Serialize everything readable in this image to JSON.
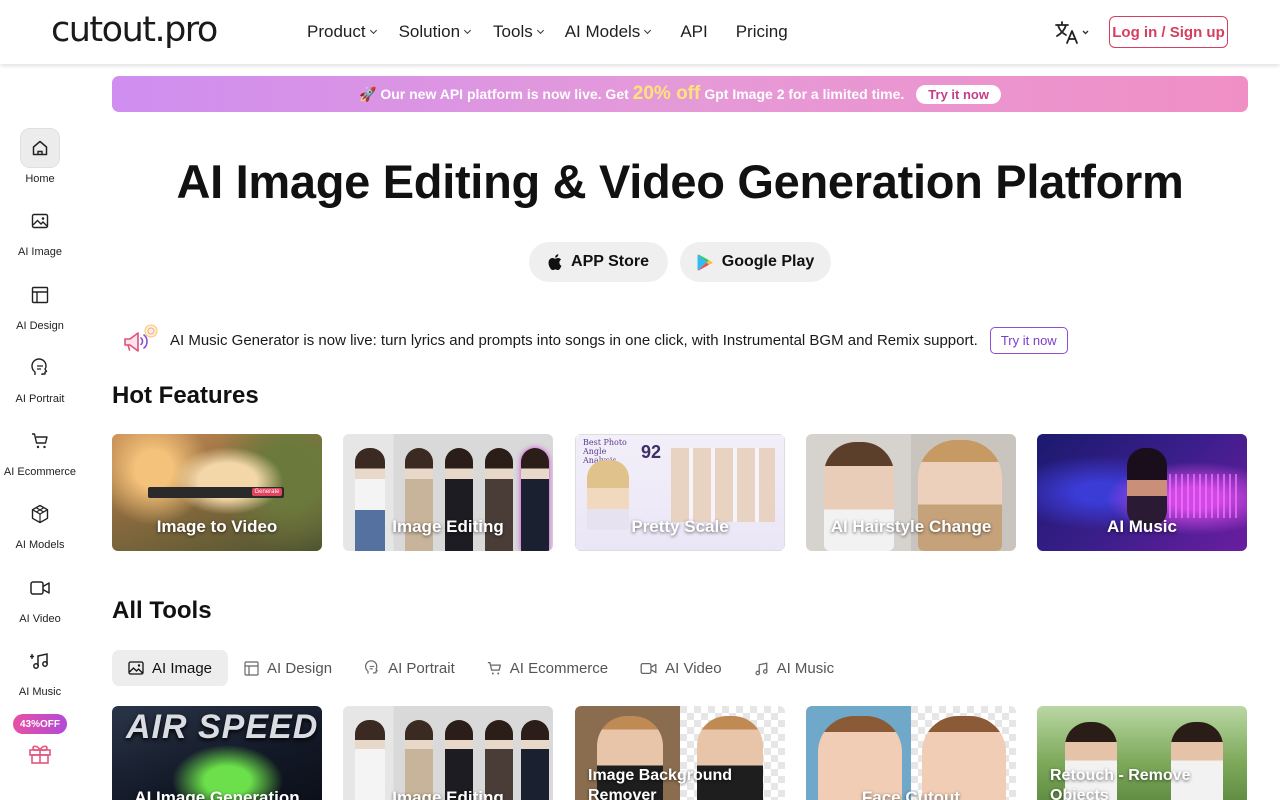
{
  "brand": {
    "logo": "cutout.pro",
    "accent": "#d63d5e"
  },
  "nav": {
    "items": [
      {
        "label": "Product",
        "dropdown": true
      },
      {
        "label": "Solution",
        "dropdown": true
      },
      {
        "label": "Tools",
        "dropdown": true
      },
      {
        "label": "AI Models",
        "dropdown": true
      },
      {
        "label": "API",
        "dropdown": false
      },
      {
        "label": "Pricing",
        "dropdown": false
      }
    ],
    "language_icon": "translate-icon",
    "login_label": "Log in / Sign up"
  },
  "sidebar": {
    "items": [
      {
        "label": "Home",
        "icon": "home-icon",
        "active": true
      },
      {
        "label": "AI Image",
        "icon": "image-icon"
      },
      {
        "label": "AI Design",
        "icon": "layout-icon"
      },
      {
        "label": "AI Portrait",
        "icon": "portrait-icon"
      },
      {
        "label": "AI Ecommerce",
        "icon": "cart-icon"
      },
      {
        "label": "AI Models",
        "icon": "cube-icon"
      },
      {
        "label": "AI Video",
        "icon": "video-icon"
      },
      {
        "label": "AI Music",
        "icon": "music-icon"
      }
    ],
    "offer_badge": "43%OFF",
    "gift_icon": "gift-icon"
  },
  "promo": {
    "prefix": "🚀 Our new API platform is now live. Get",
    "highlight": "20% off",
    "suffix": "Gpt Image 2 for a limited time.",
    "cta": "Try it now"
  },
  "hero": {
    "title": "AI Image Editing & Video Generation Platform",
    "app_store": "APP Store",
    "google_play": "Google Play"
  },
  "announcement": {
    "text": "AI Music Generator is now live: turn lyrics and prompts into songs in one click, with Instrumental BGM and Remix support.",
    "cta": "Try it now"
  },
  "hot_features": {
    "title": "Hot Features",
    "cards": [
      {
        "label": "Image to Video",
        "button_text": "Generate"
      },
      {
        "label": "Image Editing"
      },
      {
        "label": "Pretty Scale",
        "overlay_title": "Best Photo Angle Analysis",
        "overlay_score": "92"
      },
      {
        "label": "AI Hairstyle Change"
      },
      {
        "label": "AI Music"
      }
    ]
  },
  "all_tools": {
    "title": "All Tools",
    "tabs": [
      {
        "label": "AI Image",
        "icon": "image-icon",
        "active": true
      },
      {
        "label": "AI Design",
        "icon": "layout-icon"
      },
      {
        "label": "AI Portrait",
        "icon": "portrait-icon"
      },
      {
        "label": "AI Ecommerce",
        "icon": "cart-icon"
      },
      {
        "label": "AI Video",
        "icon": "video-icon"
      },
      {
        "label": "AI Music",
        "icon": "music-icon"
      }
    ],
    "cards": [
      {
        "label": "AI Image Generation",
        "overlay_text": "AIR SPEED"
      },
      {
        "label": "Image Editing"
      },
      {
        "label": "Image Background Remover"
      },
      {
        "label": "Face Cutout"
      },
      {
        "label": "Retouch - Remove Objects"
      }
    ]
  }
}
